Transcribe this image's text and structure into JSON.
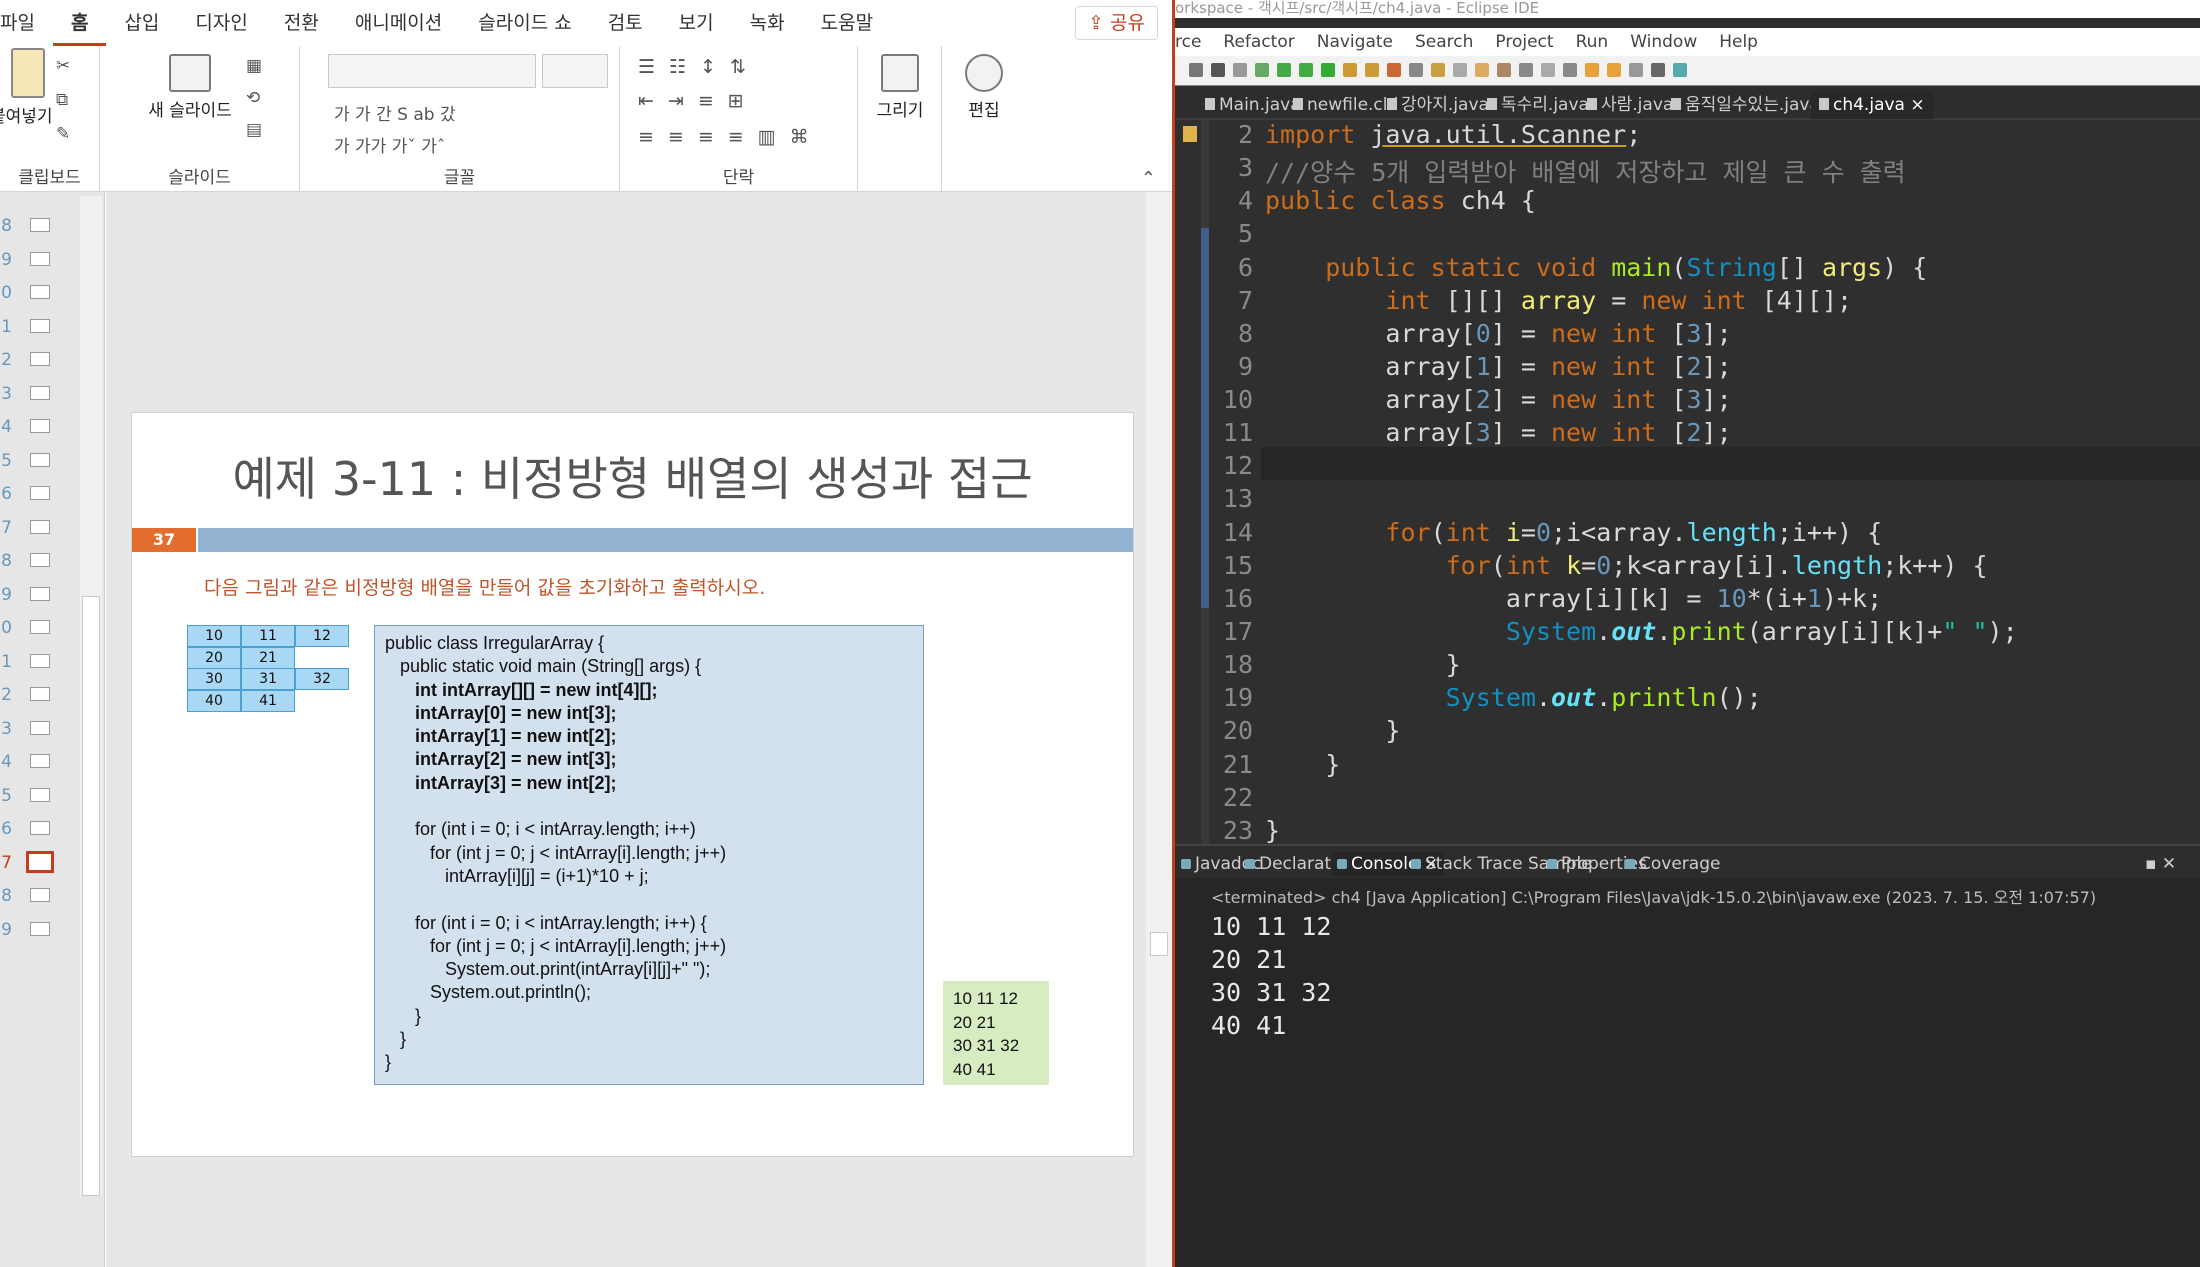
{
  "ppt": {
    "menu": [
      "파일",
      "홈",
      "삽입",
      "디자인",
      "전환",
      "애니메이션",
      "슬라이드 쇼",
      "검토",
      "보기",
      "녹화",
      "도움말"
    ],
    "active_menu": "홈",
    "share_label": "공유",
    "ribbon": {
      "clipboard": {
        "paste_label": "붙여넣기",
        "group_label": "클립보드"
      },
      "slides": {
        "new_slide_label": "새 슬라이드",
        "group_label": "슬라이드"
      },
      "font": {
        "group_label": "글꼴",
        "row1": "가  가  간  S  ab  갔",
        "row2": "가  가가  가ˇ  가ˆ"
      },
      "paragraph": {
        "group_label": "단락"
      },
      "draw": {
        "label": "그리기"
      },
      "edit": {
        "label": "편집"
      }
    },
    "thumbs": [
      {
        "num": "8",
        "selected": false
      },
      {
        "num": "9",
        "selected": false
      },
      {
        "num": "0",
        "selected": false
      },
      {
        "num": "1",
        "selected": false
      },
      {
        "num": "2",
        "selected": false
      },
      {
        "num": "3",
        "selected": false
      },
      {
        "num": "4",
        "selected": false
      },
      {
        "num": "5",
        "selected": false
      },
      {
        "num": "6",
        "selected": false
      },
      {
        "num": "7",
        "selected": false
      },
      {
        "num": "8",
        "selected": false
      },
      {
        "num": "9",
        "selected": false
      },
      {
        "num": "0",
        "selected": false
      },
      {
        "num": "1",
        "selected": false
      },
      {
        "num": "2",
        "selected": false
      },
      {
        "num": "3",
        "selected": false
      },
      {
        "num": "4",
        "selected": false
      },
      {
        "num": "5",
        "selected": false
      },
      {
        "num": "6",
        "selected": false
      },
      {
        "num": "7",
        "selected": true
      },
      {
        "num": "8",
        "selected": false
      },
      {
        "num": "9",
        "selected": false
      }
    ],
    "slide": {
      "title": "예제 3-11 : 비정방형 배열의 생성과 접근",
      "page_number": "37",
      "instruction": "다음 그림과 같은 비정방형 배열을 만들어 값을 초기화하고 출력하시오.",
      "grid": [
        [
          "10",
          "11",
          "12"
        ],
        [
          "20",
          "21"
        ],
        [
          "30",
          "31",
          "32"
        ],
        [
          "40",
          "41"
        ]
      ],
      "code_lines": [
        {
          "text": "public class IrregularArray {",
          "bold": false
        },
        {
          "text": "   public static void main (String[] args) {",
          "bold": false
        },
        {
          "text": "      int intArray[][] = new int[4][];",
          "bold": true
        },
        {
          "text": "      intArray[0] = new int[3];",
          "bold": true
        },
        {
          "text": "      intArray[1] = new int[2];",
          "bold": true
        },
        {
          "text": "      intArray[2] = new int[3];",
          "bold": true
        },
        {
          "text": "      intArray[3] = new int[2];",
          "bold": true
        },
        {
          "text": "",
          "bold": false
        },
        {
          "text": "      for (int i = 0; i < intArray.length; i++)",
          "bold": false
        },
        {
          "text": "         for (int j = 0; j < intArray[i].length; j++)",
          "bold": false
        },
        {
          "text": "            intArray[i][j] = (i+1)*10 + j;",
          "bold": false
        },
        {
          "text": "",
          "bold": false
        },
        {
          "text": "      for (int i = 0; i < intArray.length; i++) {",
          "bold": false
        },
        {
          "text": "         for (int j = 0; j < intArray[i].length; j++)",
          "bold": false
        },
        {
          "text": "            System.out.print(intArray[i][j]+\" \");",
          "bold": false
        },
        {
          "text": "         System.out.println();",
          "bold": false
        },
        {
          "text": "      }",
          "bold": false
        },
        {
          "text": "   }",
          "bold": false
        },
        {
          "text": "}",
          "bold": false
        }
      ],
      "output_lines": [
        "10 11 12",
        "20 21",
        "30 31 32",
        "40 41"
      ]
    }
  },
  "eclipse": {
    "title": "orkspace - 객시프/src/객시프/ch4.java - Eclipse IDE",
    "menu": [
      "rce",
      "Refactor",
      "Navigate",
      "Search",
      "Project",
      "Run",
      "Window",
      "Help"
    ],
    "tabs": [
      "Main.java",
      "newfile.cld",
      "강아지.java",
      "독수리.java",
      "사람.java",
      "움직일수있는.java",
      "ch4.java"
    ],
    "active_tab": "ch4.java",
    "line_numbers": [
      "2",
      "3",
      "4",
      "5",
      "6",
      "7",
      "8",
      "9",
      "10",
      "11",
      "12",
      "13",
      "14",
      "15",
      "16",
      "17",
      "18",
      "19",
      "20",
      "21",
      "22",
      "23"
    ],
    "code": {
      "l2": [
        "import ",
        "java.util.Scanner",
        ";"
      ],
      "l3": "///양수 5개 입력받아 배열에 저장하고 제일 큰 수 출력",
      "l4": [
        "public ",
        "class ",
        "ch4",
        " {"
      ],
      "l6": [
        "    public ",
        "static ",
        "void ",
        "main",
        "(",
        "String",
        "[] ",
        "args",
        ") {"
      ],
      "l7": [
        "        ",
        "int",
        " [][] ",
        "array",
        " = ",
        "new ",
        "int",
        " [4][];"
      ],
      "l8": [
        "        array[",
        "0",
        "] = ",
        "new ",
        "int",
        " [",
        "3",
        "];"
      ],
      "l9": [
        "        array[",
        "1",
        "] = ",
        "new ",
        "int",
        " [",
        "2",
        "];"
      ],
      "l10": [
        "        array[",
        "2",
        "] = ",
        "new ",
        "int",
        " [",
        "3",
        "];"
      ],
      "l11": [
        "        array[",
        "3",
        "] = ",
        "new ",
        "int",
        " [",
        "2",
        "];"
      ],
      "l14": [
        "        ",
        "for",
        "(",
        "int",
        " ",
        "i",
        "=",
        "0",
        ";i<array.",
        "length",
        ";i++) {"
      ],
      "l15": [
        "            ",
        "for",
        "(",
        "int",
        " ",
        "k",
        "=",
        "0",
        ";k<array[i].",
        "length",
        ";k++) {"
      ],
      "l16": [
        "                array[i][k] = ",
        "10",
        "*(i+",
        "1",
        ")+k;"
      ],
      "l17": [
        "                ",
        "System",
        ".",
        "out",
        ".",
        "print",
        "(array[i][k]+",
        "\" \"",
        ");"
      ],
      "l18": "            }",
      "l19": [
        "            ",
        "System",
        ".",
        "out",
        ".",
        "println",
        "();"
      ],
      "l20": "        }",
      "l21": "    }",
      "l23": "}"
    },
    "bottom_tabs": [
      "Javadoc",
      "Declaration",
      "Console",
      "Stack Trace Sample",
      "Properties",
      "Coverage"
    ],
    "active_bottom_tab": "Console",
    "terminated": "<terminated> ch4 [Java Application] C:\\Program Files\\Java\\jdk-15.0.2\\bin\\javaw.exe (2023. 7. 15. 오전 1:07:57)",
    "console_output": [
      "10 11 12",
      "20 21",
      "30 31 32",
      "40 41"
    ]
  }
}
